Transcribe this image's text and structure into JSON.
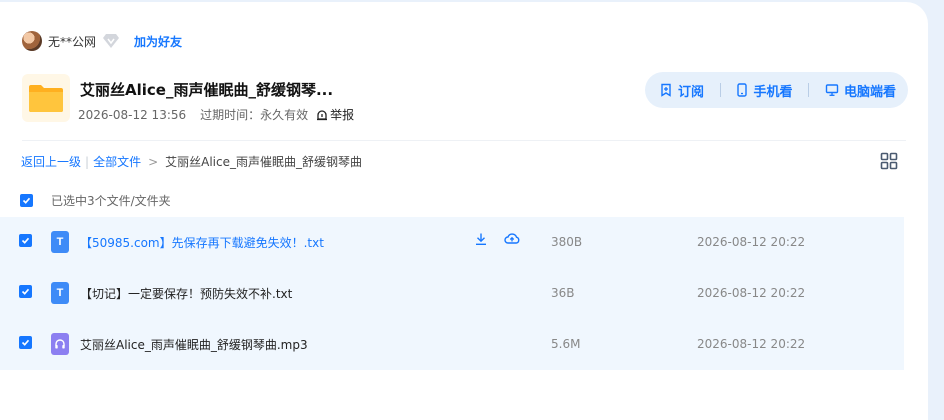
{
  "sharer": {
    "name": "无**公网",
    "add_friend_label": "加为好友"
  },
  "share": {
    "title": "艾丽丝Alice_雨声催眠曲_舒缓钢琴...",
    "date": "2026-08-12 13:56",
    "expiry_label": "过期时间：",
    "expiry_value": "永久有效",
    "report_label": "举报"
  },
  "actions": {
    "subscribe": "订阅",
    "mobile": "手机看",
    "desktop": "电脑端看"
  },
  "breadcrumb": {
    "back": "返回上一级",
    "all_files": "全部文件",
    "current": "艾丽丝Alice_雨声催眠曲_舒缓钢琴曲"
  },
  "selection": {
    "summary": "已选中3个文件/文件夹"
  },
  "files": [
    {
      "name": "【50985.com】先保存再下载避免失效！.txt",
      "size": "380B",
      "date": "2026-08-12 20:22",
      "type": "txt",
      "icon": "text-file-icon"
    },
    {
      "name": "【切记】一定要保存！预防失效不补.txt",
      "size": "36B",
      "date": "2026-08-12 20:22",
      "type": "txt",
      "icon": "text-file-icon"
    },
    {
      "name": "艾丽丝Alice_雨声催眠曲_舒缓钢琴曲.mp3",
      "size": "5.6M",
      "date": "2026-08-12 20:22",
      "type": "mp3",
      "icon": "audio-file-icon"
    }
  ],
  "colors": {
    "accent": "#1677ff",
    "row_highlight": "#f0f7fe",
    "page_bg": "#e9f1fb",
    "folder": "#ffc53d",
    "txt_icon": "#3e8bf7",
    "audio_icon": "#8c7ff1"
  }
}
